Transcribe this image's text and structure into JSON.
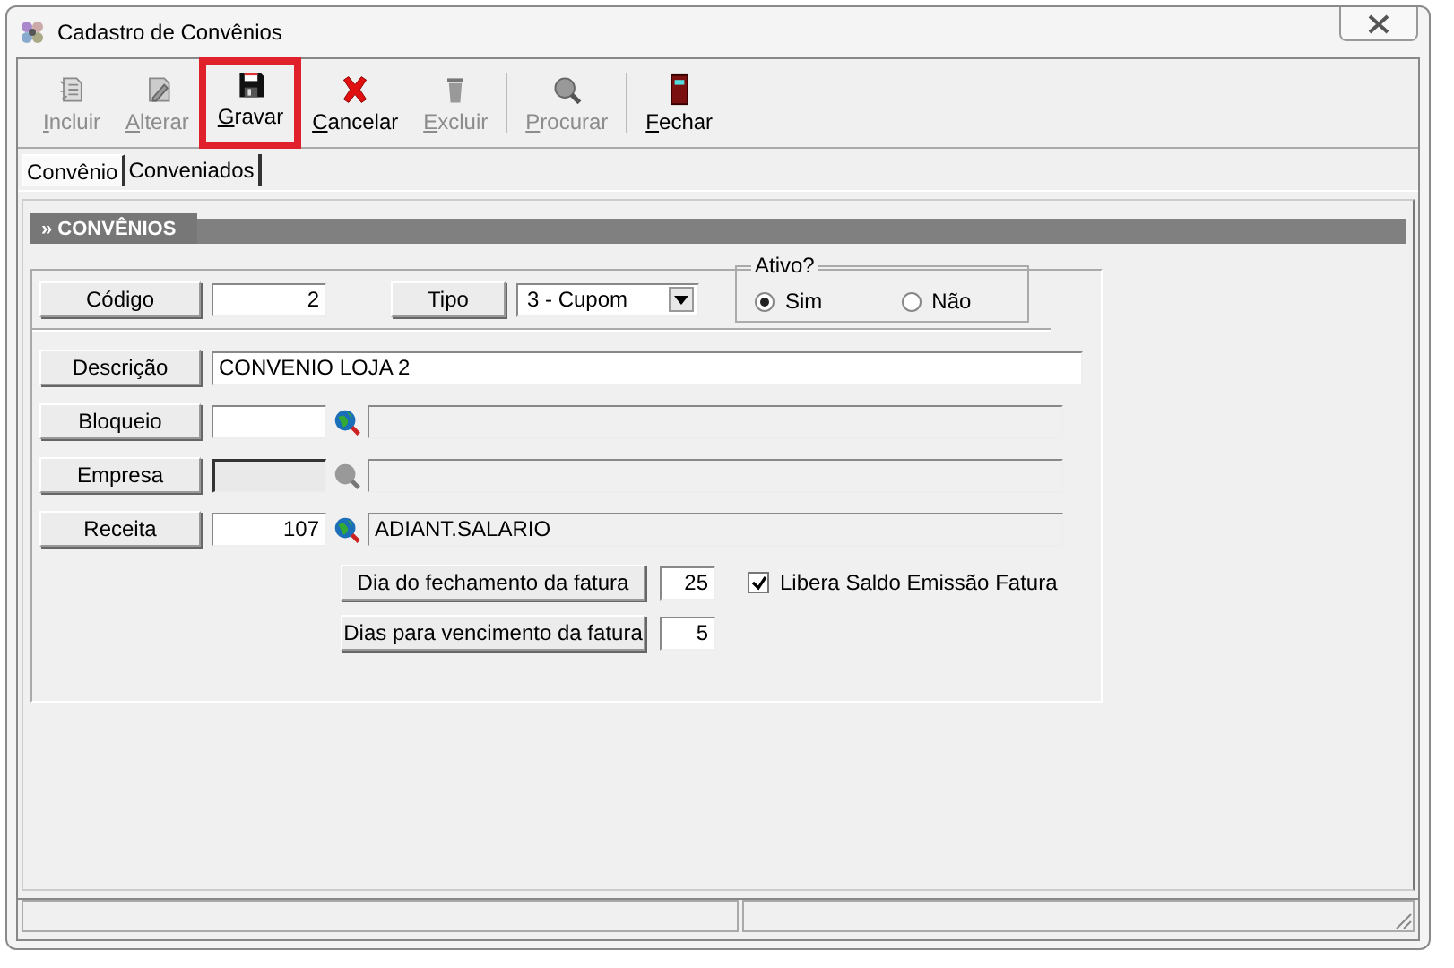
{
  "window": {
    "title": "Cadastro de Convênios"
  },
  "toolbar": {
    "groups": [
      {
        "buttons": [
          {
            "label": "Incluir",
            "kind": "new",
            "disabled": true,
            "highlighted": false
          },
          {
            "label": "Alterar",
            "kind": "edit",
            "disabled": true,
            "highlighted": false
          },
          {
            "label": "Gravar",
            "kind": "save",
            "disabled": false,
            "highlighted": true
          },
          {
            "label": "Cancelar",
            "kind": "cancel",
            "disabled": false,
            "highlighted": false
          },
          {
            "label": "Excluir",
            "kind": "delete",
            "disabled": true,
            "highlighted": false
          }
        ]
      },
      {
        "buttons": [
          {
            "label": "Procurar",
            "kind": "search",
            "disabled": true,
            "highlighted": false
          }
        ]
      },
      {
        "buttons": [
          {
            "label": "Fechar",
            "kind": "close",
            "disabled": false,
            "highlighted": false
          }
        ]
      }
    ]
  },
  "tabs": [
    {
      "label": "Convênio",
      "selected": true
    },
    {
      "label": "Conveniados",
      "selected": false
    }
  ],
  "section": {
    "title": "» CONVÊNIOS"
  },
  "form": {
    "codigo": {
      "label": "Código",
      "value": "2"
    },
    "tipo": {
      "label": "Tipo",
      "value": "3 - Cupom"
    },
    "ativo": {
      "legend": "Ativo?",
      "options": [
        {
          "label": "Sim",
          "selected": true
        },
        {
          "label": "Não",
          "selected": false
        }
      ]
    },
    "descricao": {
      "label": "Descrição",
      "value": "CONVENIO LOJA 2"
    },
    "lookups": [
      {
        "label": "Bloqueio",
        "disabled": false
      },
      {
        "label": "Empresa",
        "disabled": true
      },
      {
        "label": "Receita",
        "code": "107",
        "name": "ADIANT.SALARIO",
        "disabled": false
      }
    ],
    "fechamento": {
      "label": "Dia do fechamento da fatura",
      "value": "25"
    },
    "libera": {
      "label": "Libera Saldo Emissão Fatura",
      "checked": true
    },
    "vencimento": {
      "label": "Dias para vencimento da fatura",
      "value": "5"
    }
  }
}
